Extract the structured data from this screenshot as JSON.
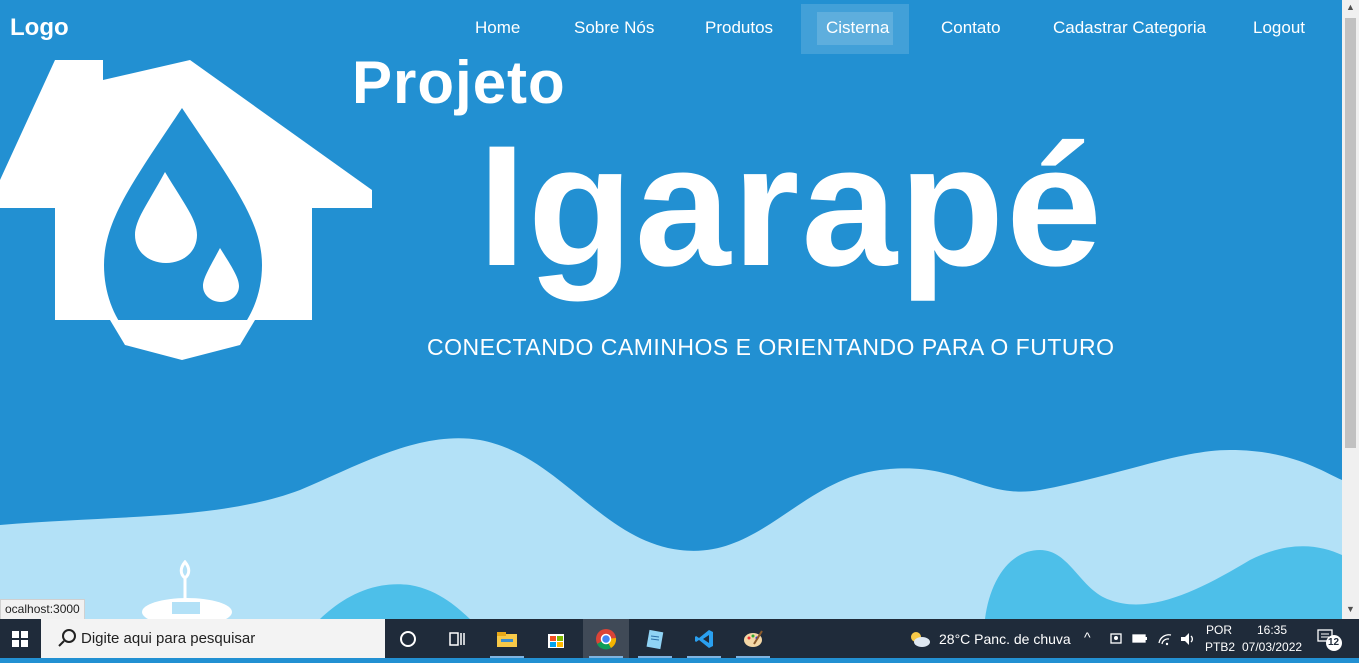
{
  "nav": {
    "logo": "Logo",
    "items": [
      "Home",
      "Sobre Nós",
      "Produtos",
      "Cisterna",
      "Contato",
      "Cadastrar Categoria",
      "Logout"
    ]
  },
  "hero": {
    "title_small": "Projeto",
    "title_big": "Igarapé",
    "tagline": "CONECTANDO CAMINHOS E ORIENTANDO PARA O FUTURO"
  },
  "status_bar": {
    "url": "ocalhost:3000"
  },
  "taskbar": {
    "search_placeholder": "Digite aqui para pesquisar",
    "weather": "28°C  Panc. de chuva",
    "lang": "POR",
    "layout": "PTB2",
    "time": "16:35",
    "date": "07/03/2022",
    "notifications": "12"
  },
  "colors": {
    "background": "#2290d2",
    "wave_light": "#b3e1f7",
    "wave_mid": "#4dbfe9"
  }
}
